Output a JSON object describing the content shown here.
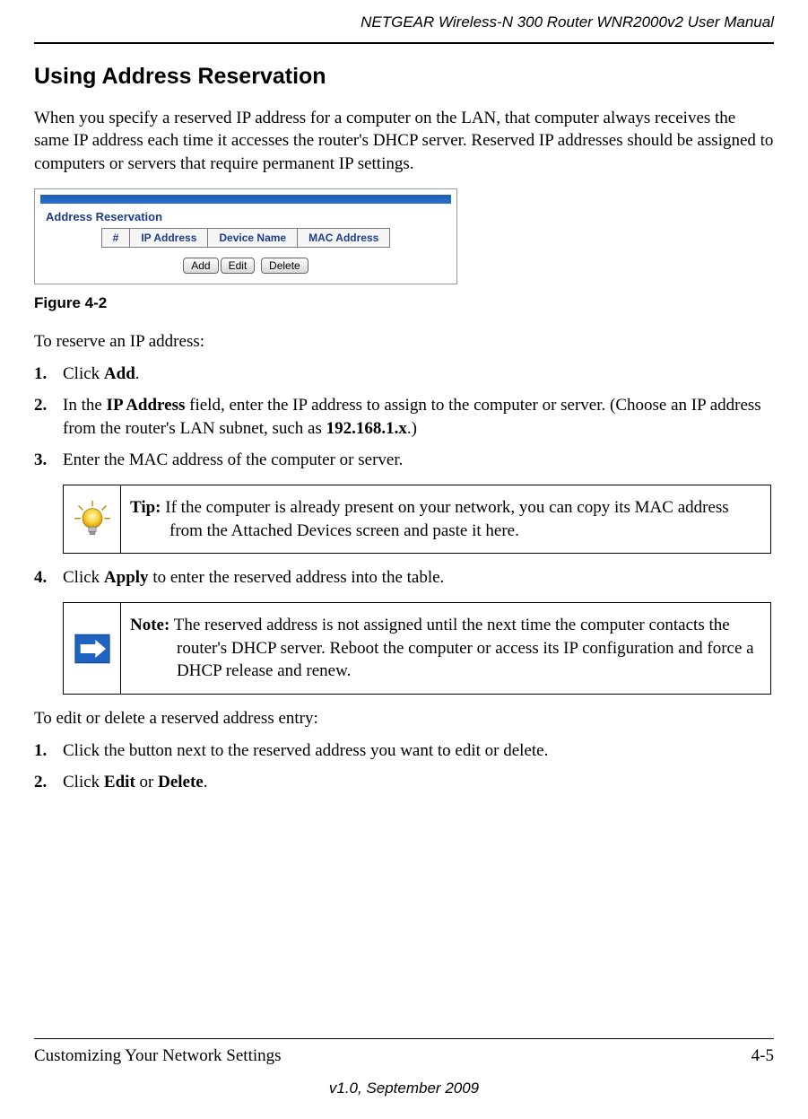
{
  "header": {
    "doc_title": "NETGEAR Wireless-N 300 Router WNR2000v2 User Manual"
  },
  "section": {
    "title": "Using Address Reservation",
    "intro": "When you specify a reserved IP address for a computer on the LAN, that computer always receives the same IP address each time it accesses the router's DHCP server. Reserved IP addresses should be assigned to computers or servers that require permanent IP settings."
  },
  "figure": {
    "panel_title": "Address Reservation",
    "cols": {
      "num": "#",
      "ip": "IP Address",
      "device": "Device Name",
      "mac": "MAC Address"
    },
    "buttons": {
      "add": "Add",
      "edit": "Edit",
      "delete": "Delete"
    },
    "caption": "Figure 4-2"
  },
  "reserve": {
    "lead": "To reserve an IP address:",
    "s1_a": "Click ",
    "s1_b": "Add",
    "s1_c": ".",
    "s2_a": "In the ",
    "s2_b": "IP Address",
    "s2_c": " field, enter the IP address to assign to the computer or server. (Choose an IP address from the router's LAN subnet, such as ",
    "s2_d": "192.168.1.x",
    "s2_e": ".)",
    "s3": "Enter the MAC address of the computer or server.",
    "s4_a": "Click ",
    "s4_b": "Apply",
    "s4_c": " to enter the reserved address into the table."
  },
  "tip": {
    "label": "Tip:",
    "text": " If the computer is already present on your network, you can copy its MAC address from the Attached Devices screen and paste it here."
  },
  "note": {
    "label": "Note:",
    "text": " The reserved address is not assigned until the next time the computer contacts the router's DHCP server. Reboot the computer or access its IP configuration and force a DHCP release and renew."
  },
  "edit": {
    "lead": "To edit or delete a reserved address entry:",
    "s1": "Click the button next to the reserved address you want to edit or delete.",
    "s2_a": "Click ",
    "s2_b": "Edit",
    "s2_c": " or ",
    "s2_d": "Delete",
    "s2_e": "."
  },
  "footer": {
    "left": "Customizing Your Network Settings",
    "right": "4-5",
    "center": "v1.0, September 2009"
  }
}
